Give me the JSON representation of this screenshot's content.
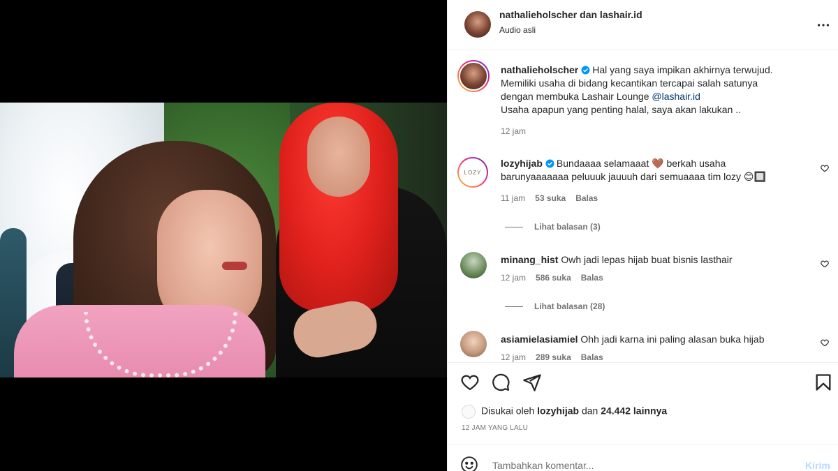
{
  "header": {
    "title": "nathalieholscher dan lashair.id",
    "subtitle": "Audio asli",
    "more_icon": "more-horizontal-icon"
  },
  "caption": {
    "username": "nathalieholscher",
    "text_1": "Hal yang saya impikan akhirnya terwujud.",
    "text_2": "Memiliki usaha di bidang kecantikan tercapai salah satunya",
    "text_3": "dengan membuka Lashair Lounge",
    "mention": "@lashair.id",
    "text_4": "Usaha apapun yang penting halal, saya akan lakukan ..",
    "time": "12 jam"
  },
  "comments": [
    {
      "username": "lozyhijab",
      "text_1": "Bundaaaa selamaaat 🤎 berkah usaha",
      "text_2": "barunyaaaaaaa peluuuk jauuuh dari semuaaaa tim lozy 😊🔲",
      "time": "11 jam",
      "likes": "53 suka",
      "reply": "Balas",
      "view_replies": "Lihat balasan (3)",
      "avatar_text": "LOZY"
    },
    {
      "username": "minang_hist",
      "text_1": "Owh jadi lepas hijab buat bisnis lasthair",
      "time": "12 jam",
      "likes": "586 suka",
      "reply": "Balas",
      "view_replies": "Lihat balasan (28)"
    },
    {
      "username": "asiamielasiamiel",
      "text_1": "Ohh jadi karna ini paling alasan buka hijab",
      "time": "12 jam",
      "likes": "289 suka",
      "reply": "Balas"
    }
  ],
  "likes_line": {
    "prefix": "Disukai oleh",
    "user": "lozyhijab",
    "middle": "dan",
    "count": "24.442 lainnya"
  },
  "time_ago": "12 JAM YANG LALU",
  "add_comment": {
    "placeholder": "Tambahkan komentar...",
    "post_label": "Kirim"
  },
  "colors": {
    "text": "#262626",
    "muted": "#737373",
    "link": "#00376b",
    "verified": "#0095f6",
    "post_disabled": "#b3dbff"
  }
}
